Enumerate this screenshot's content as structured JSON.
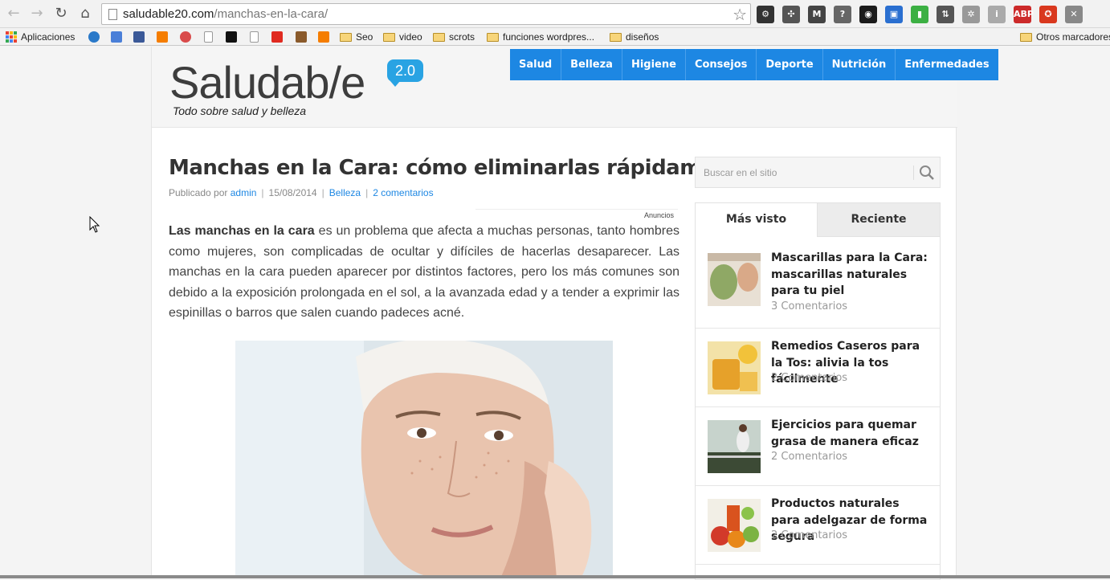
{
  "browser": {
    "url_domain": "saludable20.com",
    "url_path": "/manchas-en-la-cara/",
    "back_icon": "back-arrow-icon",
    "forward_icon": "forward-arrow-icon",
    "reload_icon": "reload-icon",
    "home_icon": "home-icon",
    "star_icon": "bookmark-star-icon",
    "extensions": [
      {
        "name": "settings-extension-icon",
        "glyph": "⚙",
        "color": "#333333"
      },
      {
        "name": "puzzle-extension-icon",
        "glyph": "✣",
        "color": "#555555"
      },
      {
        "name": "m-extension-icon",
        "glyph": "M",
        "color": "#444444"
      },
      {
        "name": "measure-extension-icon",
        "glyph": "?",
        "color": "#666666"
      },
      {
        "name": "camera-extension-icon",
        "glyph": "◉",
        "color": "#1b1b1b"
      },
      {
        "name": "ruler-extension-icon",
        "glyph": "▣",
        "color": "#2a6fd0"
      },
      {
        "name": "battery-extension-icon",
        "glyph": "▮",
        "color": "#3cb043"
      },
      {
        "name": "sort-extension-icon",
        "glyph": "⇅",
        "color": "#555555"
      },
      {
        "name": "gear-extension-icon",
        "glyph": "✲",
        "color": "#999999"
      },
      {
        "name": "info-extension-icon",
        "glyph": "i",
        "color": "#aaaaaa"
      },
      {
        "name": "abp-extension-icon",
        "glyph": "ABP",
        "color": "#cc2a2a"
      },
      {
        "name": "flag-extension-icon",
        "glyph": "✪",
        "color": "#d9381e"
      },
      {
        "name": "menu-icon",
        "glyph": "✕",
        "color": "#888888"
      }
    ]
  },
  "bookmarks": {
    "apps": "Aplicaciones",
    "folders": [
      "Seo",
      "video",
      "scrots",
      "funciones wordpres...",
      "diseños"
    ],
    "other": "Otros marcadores"
  },
  "site": {
    "logo": "Saludab/e",
    "logo_badge": "2.0",
    "tagline": "Todo sobre salud y belleza",
    "nav": [
      "Salud",
      "Belleza",
      "Higiene",
      "Consejos",
      "Deporte",
      "Nutrición",
      "Enfermedades"
    ]
  },
  "post": {
    "title": "Manchas en la Cara: cómo eliminarlas rápidamente",
    "meta_prefix": "Publicado por",
    "author": "admin",
    "date": "15/08/2014",
    "category": "Belleza",
    "comments": "2 comentarios",
    "ads_label": "Anuncios",
    "lead_bold": "Las manchas en la cara",
    "lead_rest": " es un problema que afecta a muchas personas, tanto hombres como mujeres, son complicadas de ocultar y difíciles de hacerlas desaparecer. Las manchas en la cara pueden aparecer por distintos factores, pero los más comunes son debido a la exposición prolongada en el sol, a la avanzada edad y a tender a exprimir las espinillas o barros que salen cuando padeces acné."
  },
  "sidebar": {
    "search_placeholder": "Buscar en el sitio",
    "tabs": [
      "Más visto",
      "Reciente"
    ],
    "posts": [
      {
        "title": "Mascarillas para la Cara: mascarillas naturales para tu piel",
        "comments": "3 Comentarios"
      },
      {
        "title": "Remedios Caseros para la Tos: alivia la tos fácilmente",
        "comments": "2 Comentarios"
      },
      {
        "title": "Ejercicios para quemar grasa de manera eficaz",
        "comments": "2 Comentarios"
      },
      {
        "title": "Productos naturales para adelgazar de forma segura",
        "comments": "2 Comentarios"
      }
    ]
  },
  "colors": {
    "nav_blue": "#1d87e3",
    "link_blue": "#1d87e3",
    "badge_blue": "#29a3e3"
  }
}
